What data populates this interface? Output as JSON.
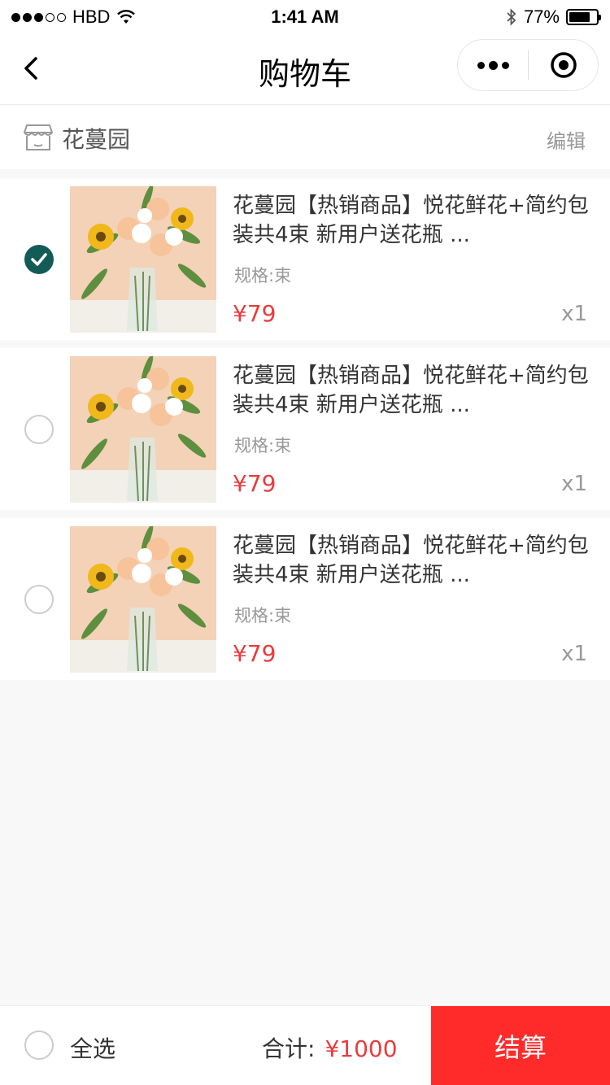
{
  "status_bar": {
    "carrier": "HBD",
    "time": "1:41 AM",
    "battery_text": "77%",
    "battery_level": 0.77
  },
  "nav": {
    "title": "购物车",
    "back_icon": "chevron-left-icon",
    "more_icon": "more-dots-icon",
    "close_icon": "target-circle-icon"
  },
  "shop": {
    "icon": "shop-icon",
    "name": "花蔓园",
    "edit_label": "编辑"
  },
  "items": [
    {
      "checked": true,
      "title": "花蔓园【热销商品】悦花鲜花+简约包装共4束 新用户送花瓶 ...",
      "spec": "规格:束",
      "price": "¥79",
      "qty": "x1"
    },
    {
      "checked": false,
      "title": "花蔓园【热销商品】悦花鲜花+简约包装共4束 新用户送花瓶 ...",
      "spec": "规格:束",
      "price": "¥79",
      "qty": "x1"
    },
    {
      "checked": false,
      "title": "花蔓园【热销商品】悦花鲜花+简约包装共4束 新用户送花瓶 ...",
      "spec": "规格:束",
      "price": "¥79",
      "qty": "x1"
    }
  ],
  "footer": {
    "select_all_label": "全选",
    "total_label": "合计:",
    "total_amount": "¥1000",
    "checkout_label": "结算"
  },
  "colors": {
    "accent_checked": "#125b57",
    "price_red": "#e93b3d",
    "checkout_red": "#ff2b2b"
  }
}
